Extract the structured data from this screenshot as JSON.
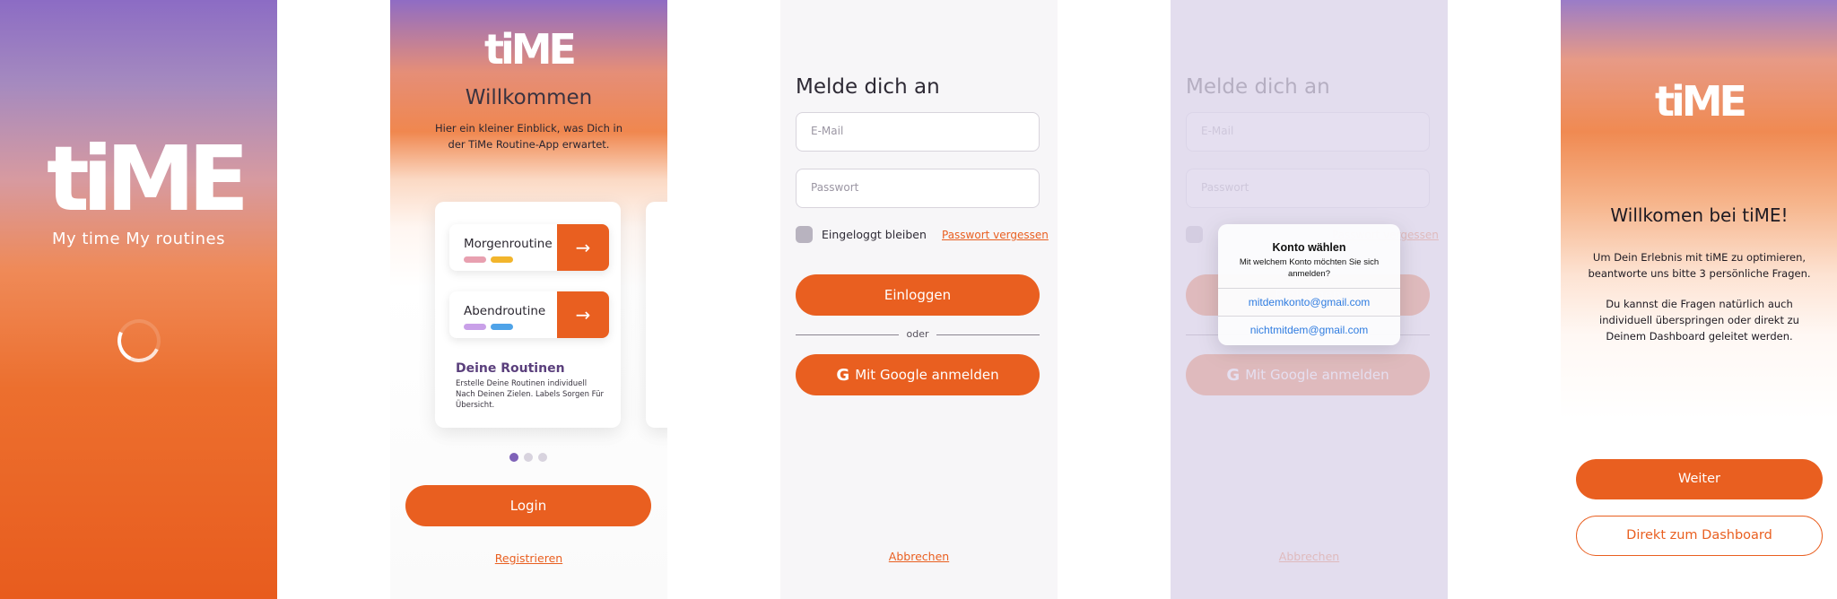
{
  "splash": {
    "logo": "tiME",
    "tagline": "My time My routines"
  },
  "welcome": {
    "logo": "tiME",
    "title": "Willkommen",
    "subtitle": "Hier ein kleiner Einblick, was Dich in der TiMe Routine-App erwartet.",
    "routines": [
      {
        "label": "Morgenroutine",
        "tag_colors": [
          "#e8a0b0",
          "#f2b52c"
        ]
      },
      {
        "label": "Abendroutine",
        "tag_colors": [
          "#c9a0e8",
          "#4fa3e8"
        ]
      }
    ],
    "card_title": "Deine Routinen",
    "card_text": "Erstelle Deine Routinen individuell Nach Deinen Zielen. Labels Sorgen Für Übersicht.",
    "pages": 3,
    "active_page": 1,
    "login_button": "Login",
    "register_link": "Registrieren"
  },
  "login": {
    "title": "Melde dich an",
    "email_placeholder": "E-Mail",
    "password_placeholder": "Passwort",
    "stay_logged_in": "Eingeloggt bleiben",
    "forgot_password": "Passwort vergessen",
    "login_button": "Einloggen",
    "divider": "oder",
    "google_button": "Mit Google anmelden",
    "cancel": "Abbrechen"
  },
  "account_chooser": {
    "title": "Konto wählen",
    "subtitle": "Mit welchem Konto möchten Sie sich anmelden?",
    "accounts": [
      "mitdemkonto@gmail.com",
      "nichtmitdem@gmail.com"
    ]
  },
  "intro": {
    "logo": "tiME",
    "title": "Willkomen bei tiME!",
    "text1": "Um Dein Erlebnis mit tiME zu optimieren, beantworte uns bitte 3 persönliche Fragen.",
    "text2": "Du kannst die Fragen natürlich auch individuell überspringen oder direkt zu Deinem Dashboard geleitet werden.",
    "next_button": "Weiter",
    "dashboard_button": "Direkt zum Dashboard"
  },
  "colors": {
    "accent": "#e95f20",
    "purple": "#7f62b8"
  }
}
